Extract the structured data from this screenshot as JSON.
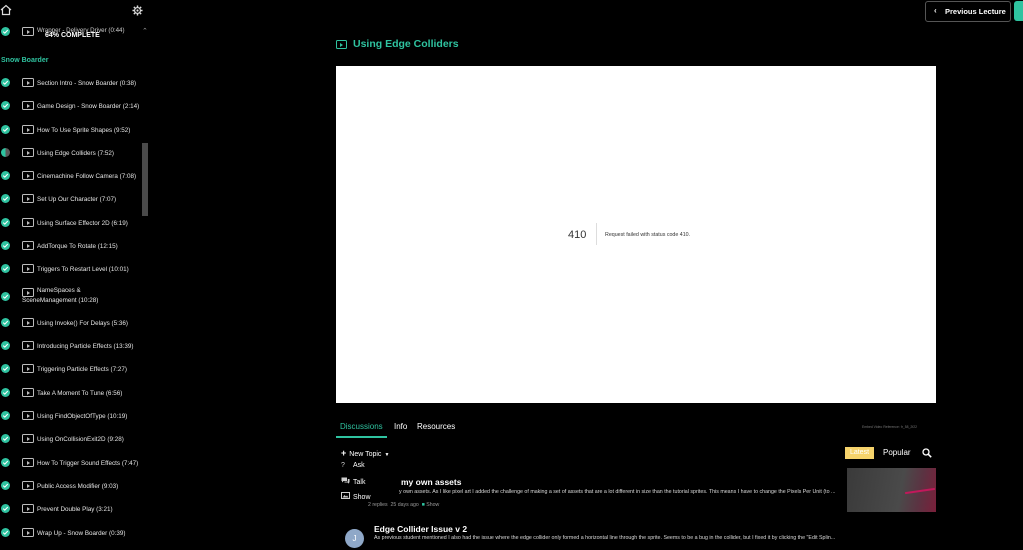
{
  "sidebar": {
    "progress_label": "64% COMPLETE",
    "previous_item_title": "Wrapper - Delivery Driver (0:44)",
    "section_title": "Snow Boarder",
    "lectures": [
      {
        "title": "Section Intro - Snow Boarder (0:38)",
        "status": "complete"
      },
      {
        "title": "Game Design - Snow Boarder (2:14)",
        "status": "complete"
      },
      {
        "title": "How To Use Sprite Shapes (9:52)",
        "status": "complete"
      },
      {
        "title": "Using Edge Colliders (7:52)",
        "status": "in-progress"
      },
      {
        "title": "Cinemachine Follow Camera (7:08)",
        "status": "complete"
      },
      {
        "title": "Set Up Our Character (7:07)",
        "status": "complete"
      },
      {
        "title": "Using Surface Effector 2D (6:19)",
        "status": "complete"
      },
      {
        "title": "AddTorque To Rotate (12:15)",
        "status": "complete"
      },
      {
        "title": "Triggers To Restart Level (10:01)",
        "status": "complete"
      },
      {
        "title": "NameSpaces & SceneManagement (10:28)",
        "status": "complete"
      },
      {
        "title": "Using Invoke() For Delays (5:36)",
        "status": "complete"
      },
      {
        "title": "Introducing Particle Effects (13:39)",
        "status": "complete"
      },
      {
        "title": "Triggering Particle Effects (7:27)",
        "status": "complete"
      },
      {
        "title": "Take A Moment To Tune (6:56)",
        "status": "complete"
      },
      {
        "title": "Using FindObjectOfType (10:19)",
        "status": "complete"
      },
      {
        "title": "Using OnCollisionExit2D (9:28)",
        "status": "complete"
      },
      {
        "title": "How To Trigger Sound Effects (7:47)",
        "status": "complete"
      },
      {
        "title": "Public Access Modifier (9:03)",
        "status": "complete"
      },
      {
        "title": "Prevent Double Play (3:21)",
        "status": "complete"
      },
      {
        "title": "Wrap Up - Snow Boarder (0:39)",
        "status": "complete"
      }
    ]
  },
  "header": {
    "previous_lecture_label": "Previous Lecture"
  },
  "main": {
    "lecture_title": "Using Edge Colliders",
    "video": {
      "error_code": "410",
      "error_message": "Request failed with status code 410."
    },
    "tabs": [
      {
        "label": "Discussions",
        "active": true
      },
      {
        "label": "Info",
        "active": false
      },
      {
        "label": "Resources",
        "active": false
      }
    ],
    "video_reference": "Embed Video Reference: fr_58_2f22",
    "discussions": {
      "new_topic_label": "New Topic",
      "menu": [
        {
          "label": "Ask",
          "icon": "question-icon"
        },
        {
          "label": "Talk",
          "icon": "chat-bubbles-icon"
        },
        {
          "label": "Show",
          "icon": "image-icon"
        }
      ],
      "sort_latest": "Latest",
      "sort_popular": "Popular",
      "topics": [
        {
          "title": "my own assets",
          "excerpt": "y own assets. As I like pixel art I added the challenge of making a set of assets that are a lot different in size than the tutorial sprites. This means I have to change the Pixels Per Unit (to ...",
          "replies": "2 replies",
          "age": "25 days ago",
          "type": "Show"
        },
        {
          "title": "Edge Collider Issue v 2",
          "avatar_initial": "J",
          "excerpt": "As previous student mentioned I also had the issue where the edge collider only formed a horizontal line through the sprite. Seems to be a bug in the collider, but I fixed it by clicking the \"Edit Splin..."
        }
      ]
    }
  },
  "colors": {
    "accent": "#2fc3a0",
    "latest_badge": "#f6d36b",
    "background": "#000000"
  }
}
